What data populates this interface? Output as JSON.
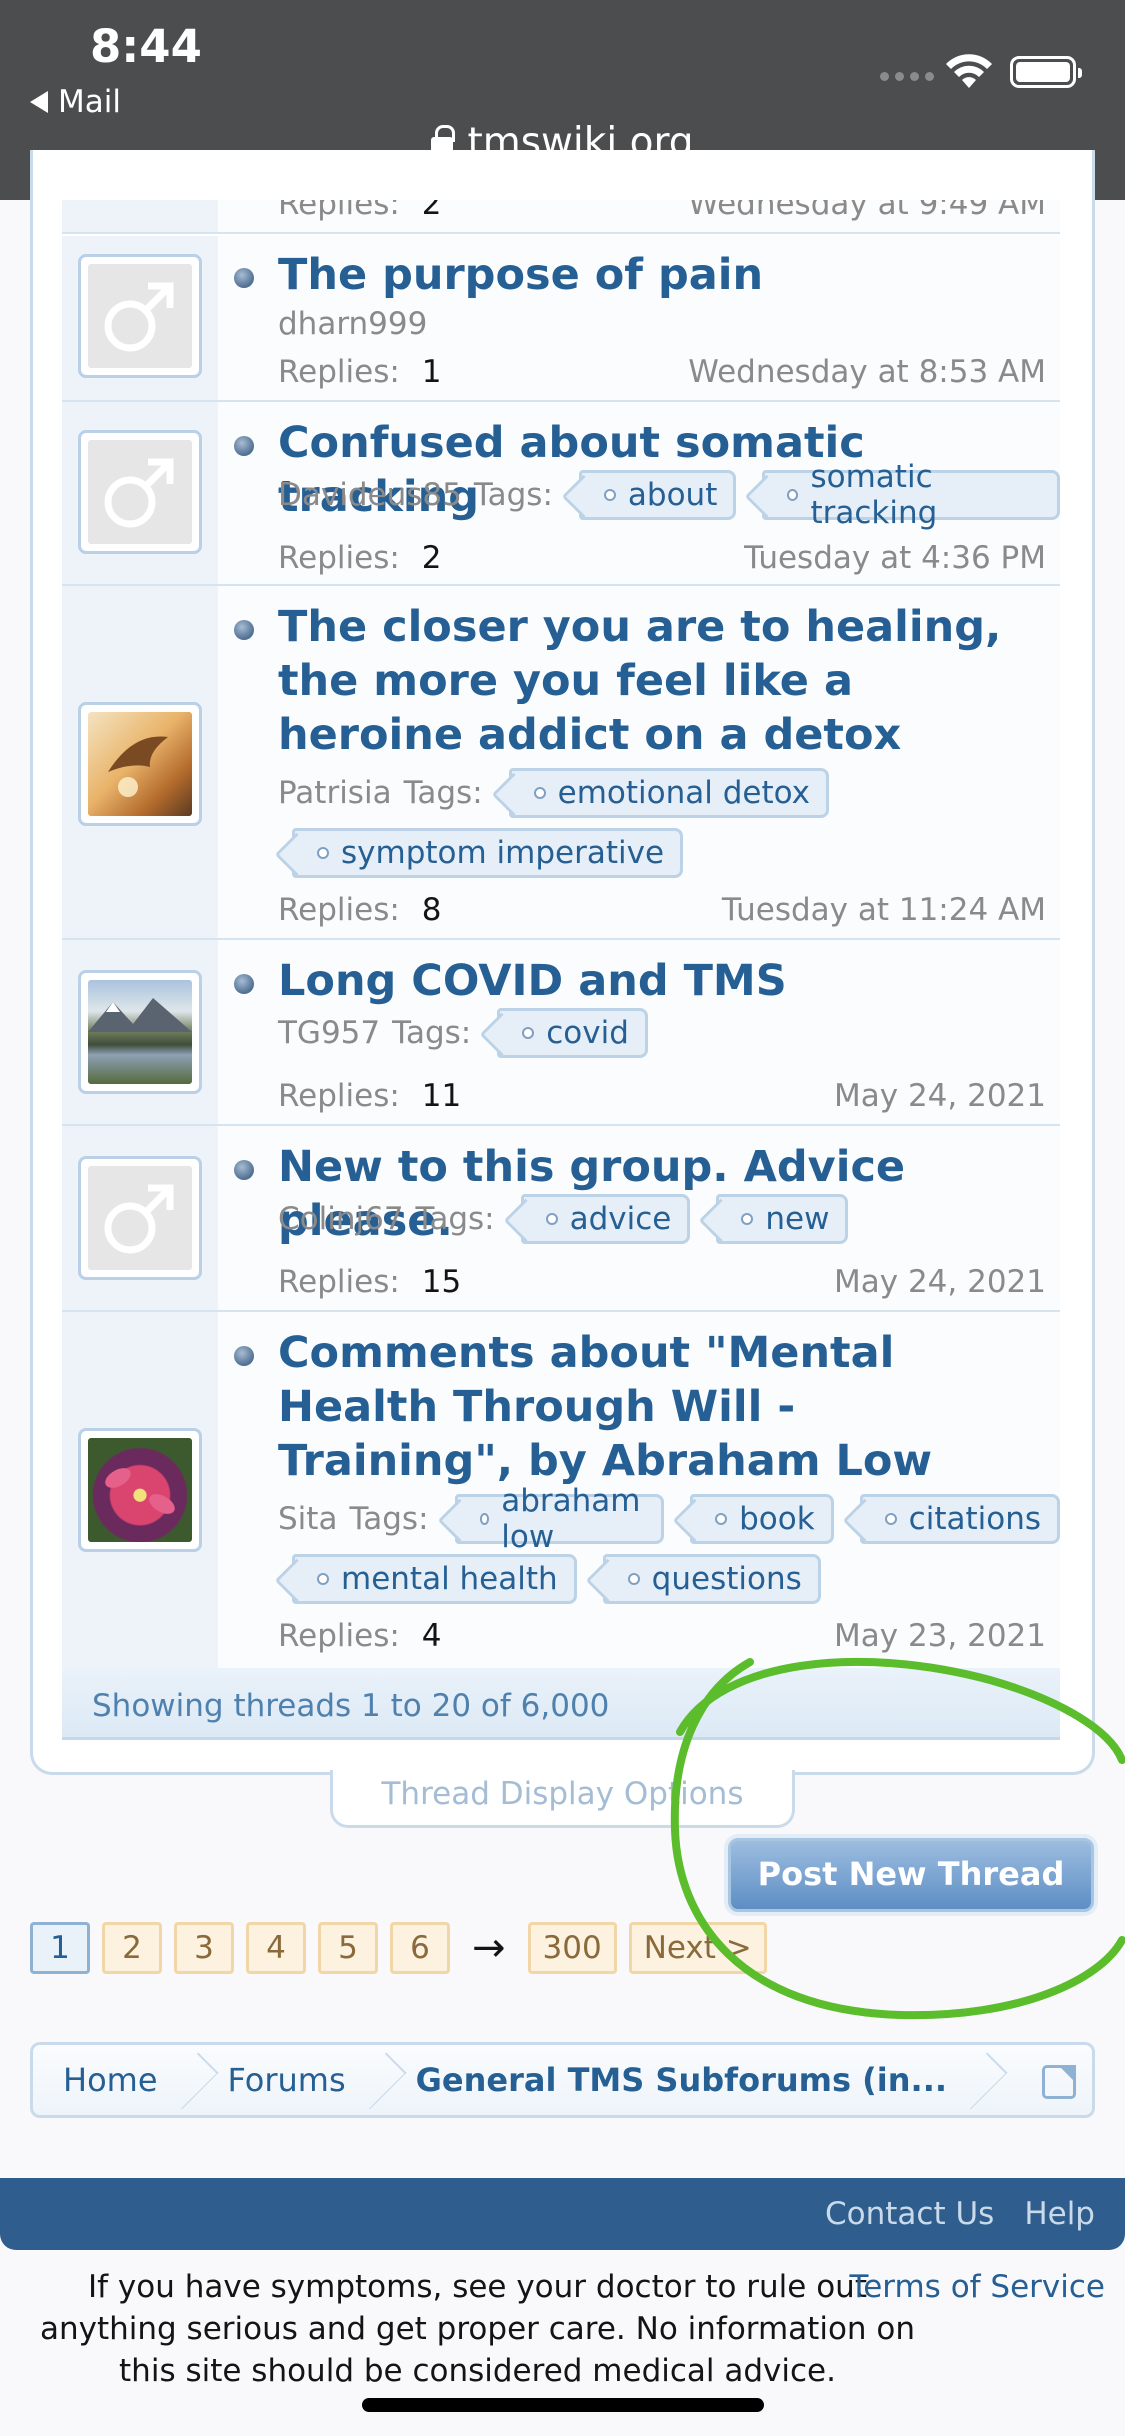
{
  "status": {
    "time": "8:44",
    "back_app": "Mail",
    "url": "tmswiki.org"
  },
  "top_partial": {
    "replies_label": "Replies:",
    "replies": "2",
    "date": "Wednesday at 9:49 AM"
  },
  "threads": [
    {
      "title": "The purpose of pain",
      "author": "dharn999",
      "tags_label": "",
      "tags": [],
      "replies_label": "Replies:",
      "replies": "1",
      "date": "Wednesday at 8:53 AM",
      "avatar": "default-male"
    },
    {
      "title": "Confused about somatic tracking",
      "author": "Davideus85",
      "tags_label": "Tags:",
      "tags": [
        "about",
        "somatic tracking"
      ],
      "replies_label": "Replies:",
      "replies": "2",
      "date": "Tuesday at 4:36 PM",
      "avatar": "default-male"
    },
    {
      "title": "The closer you are to healing, the more you feel like a heroine addict on a detox",
      "author": "Patrisia",
      "tags_label": "Tags:",
      "tags": [
        "emotional detox",
        "symptom imperative"
      ],
      "replies_label": "Replies:",
      "replies": "8",
      "date": "Tuesday at 11:24 AM",
      "avatar": "bird-photo"
    },
    {
      "title": "Long COVID and TMS",
      "author": "TG957",
      "tags_label": "Tags:",
      "tags": [
        "covid"
      ],
      "replies_label": "Replies:",
      "replies": "11",
      "date": "May 24, 2021",
      "avatar": "mountain-photo"
    },
    {
      "title": "New to this group. Advice please.",
      "author": "Colinj67",
      "tags_label": "Tags:",
      "tags": [
        "advice",
        "new"
      ],
      "replies_label": "Replies:",
      "replies": "15",
      "date": "May 24, 2021",
      "avatar": "default-male"
    },
    {
      "title": "Comments about \"Mental Health Through Will - Training\", by Abraham Low",
      "author": "Sita",
      "tags_label": "Tags:",
      "tags": [
        "abraham low",
        "book",
        "citations",
        "mental health",
        "questions"
      ],
      "replies_label": "Replies:",
      "replies": "4",
      "date": "May 23, 2021",
      "avatar": "flower-photo"
    }
  ],
  "showing": "Showing threads 1 to 20 of 6,000",
  "display_options": "Thread Display Options",
  "post_button": "Post New Thread",
  "pagination": {
    "pages": [
      "1",
      "2",
      "3",
      "4",
      "5",
      "6"
    ],
    "current": "1",
    "arrow": "→",
    "last": "300",
    "next": "Next >"
  },
  "breadcrumb": [
    "Home",
    "Forums",
    "General TMS Subforums (in..."
  ],
  "footer": {
    "links": [
      "Contact Us",
      "Help"
    ],
    "tos": "Terms of Service",
    "disclaimer": "If you have symptoms, see your doctor to rule out anything serious and get proper care. No information on this site should be considered medical advice."
  },
  "colors": {
    "title_blue": "#255f93",
    "footer_bar": "#2e5d8e",
    "annotation_green": "#5bbd2b"
  }
}
